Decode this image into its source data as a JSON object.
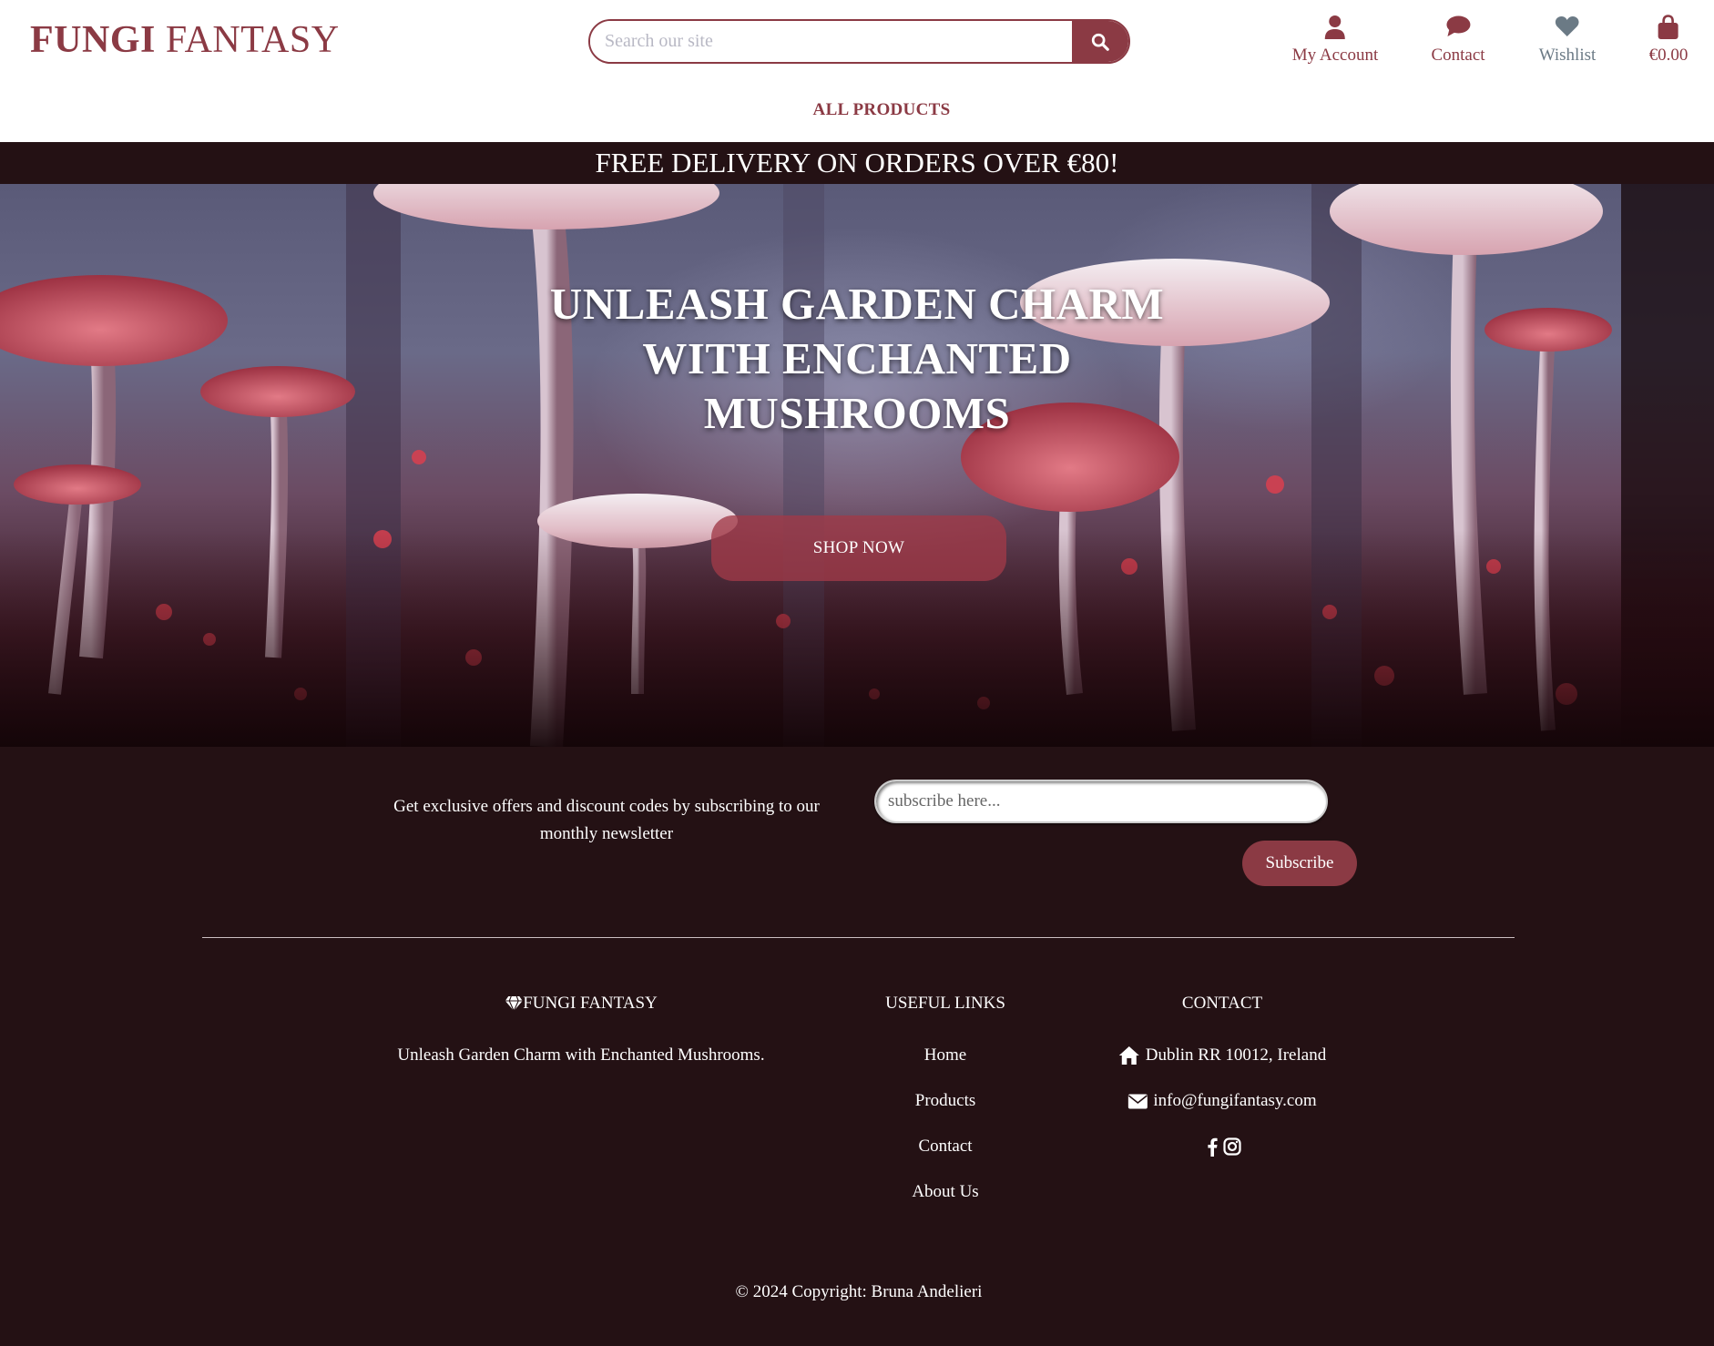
{
  "header": {
    "logo_bold": "FUNGI",
    "logo_regular": "FANTASY",
    "search_placeholder": "Search our site",
    "nav": {
      "account": "My Account",
      "contact": "Contact",
      "wishlist": "Wishlist",
      "cart_total": "€0.00"
    },
    "all_products": "ALL PRODUCTS"
  },
  "promo": "FREE DELIVERY ON ORDERS OVER €80!",
  "hero": {
    "title": "UNLEASH GARDEN CHARM WITH ENCHANTED MUSHROOMS",
    "cta": "SHOP NOW"
  },
  "newsletter": {
    "text": "Get exclusive offers and discount codes by subscribing to our monthly newsletter",
    "placeholder": "subscribe here...",
    "button": "Subscribe"
  },
  "footer": {
    "brand_heading": "FUNGI FANTASY",
    "tagline": "Unleash Garden Charm with Enchanted Mushrooms.",
    "links_heading": "USEFUL LINKS",
    "links": [
      "Home",
      "Products",
      "Contact",
      "About Us"
    ],
    "contact_heading": "CONTACT",
    "address": "Dublin RR 10012, Ireland",
    "email": "info@fungifantasy.com",
    "copyright": "© 2024 Copyright: Bruna Andelieri"
  },
  "colors": {
    "brand": "#8b3a44",
    "dark_bg": "#241114",
    "muted_icon": "#6b7a85"
  },
  "icons": {
    "search": "magnifier-icon",
    "account": "user-icon",
    "contact": "speech-bubble-icon",
    "wishlist": "heart-icon",
    "cart": "shopping-bag-icon",
    "brand": "gem-icon",
    "address": "home-icon",
    "email": "envelope-icon",
    "social": [
      "facebook-icon",
      "instagram-icon"
    ]
  }
}
